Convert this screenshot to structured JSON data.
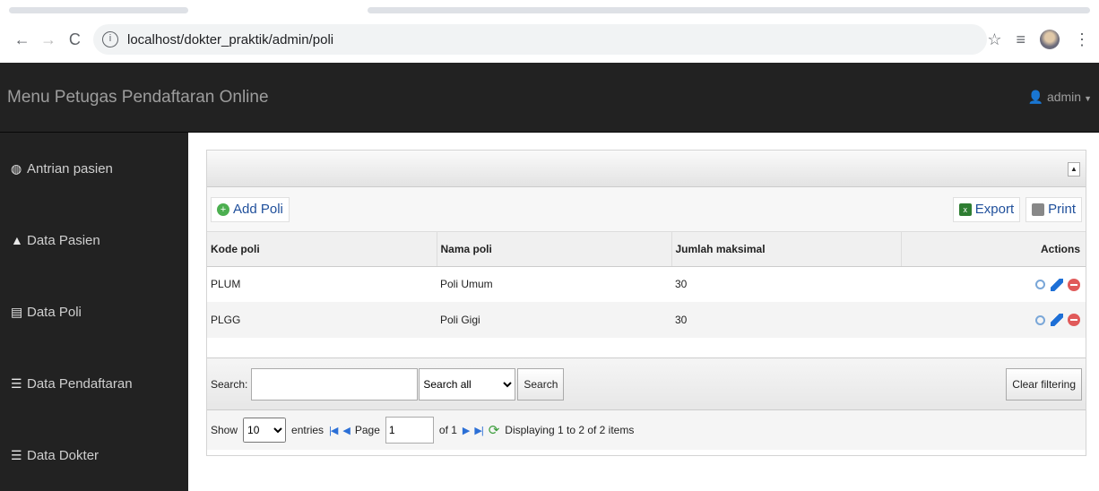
{
  "browser": {
    "url": "localhost/dokter_praktik/admin/poli"
  },
  "header": {
    "brand": "Menu Petugas Pendaftaran Online",
    "user": "admin"
  },
  "sidebar": {
    "items": [
      {
        "label": "Antrian pasien",
        "icon": "dashboard-icon"
      },
      {
        "label": "Data Pasien",
        "icon": "user-icon"
      },
      {
        "label": "Data Poli",
        "icon": "document-icon"
      },
      {
        "label": "Data Pendaftaran",
        "icon": "list-icon"
      },
      {
        "label": "Data Dokter",
        "icon": "list-icon"
      }
    ]
  },
  "grid": {
    "add_label": "Add Poli",
    "export_label": "Export",
    "print_label": "Print",
    "columns": [
      "Kode poli",
      "Nama poli",
      "Jumlah maksimal",
      "Actions"
    ],
    "rows": [
      {
        "kode": "PLUM",
        "nama": "Poli Umum",
        "jumlah": "30"
      },
      {
        "kode": "PLGG",
        "nama": "Poli Gigi",
        "jumlah": "30"
      }
    ],
    "search": {
      "label": "Search:",
      "value": "",
      "select_value": "Search all",
      "button": "Search",
      "clear": "Clear filtering"
    },
    "pager": {
      "show": "Show",
      "entries_value": "10",
      "entries": "entries",
      "page": "Page",
      "page_value": "1",
      "of": "of 1",
      "info": "Displaying 1 to 2 of 2 items"
    }
  }
}
